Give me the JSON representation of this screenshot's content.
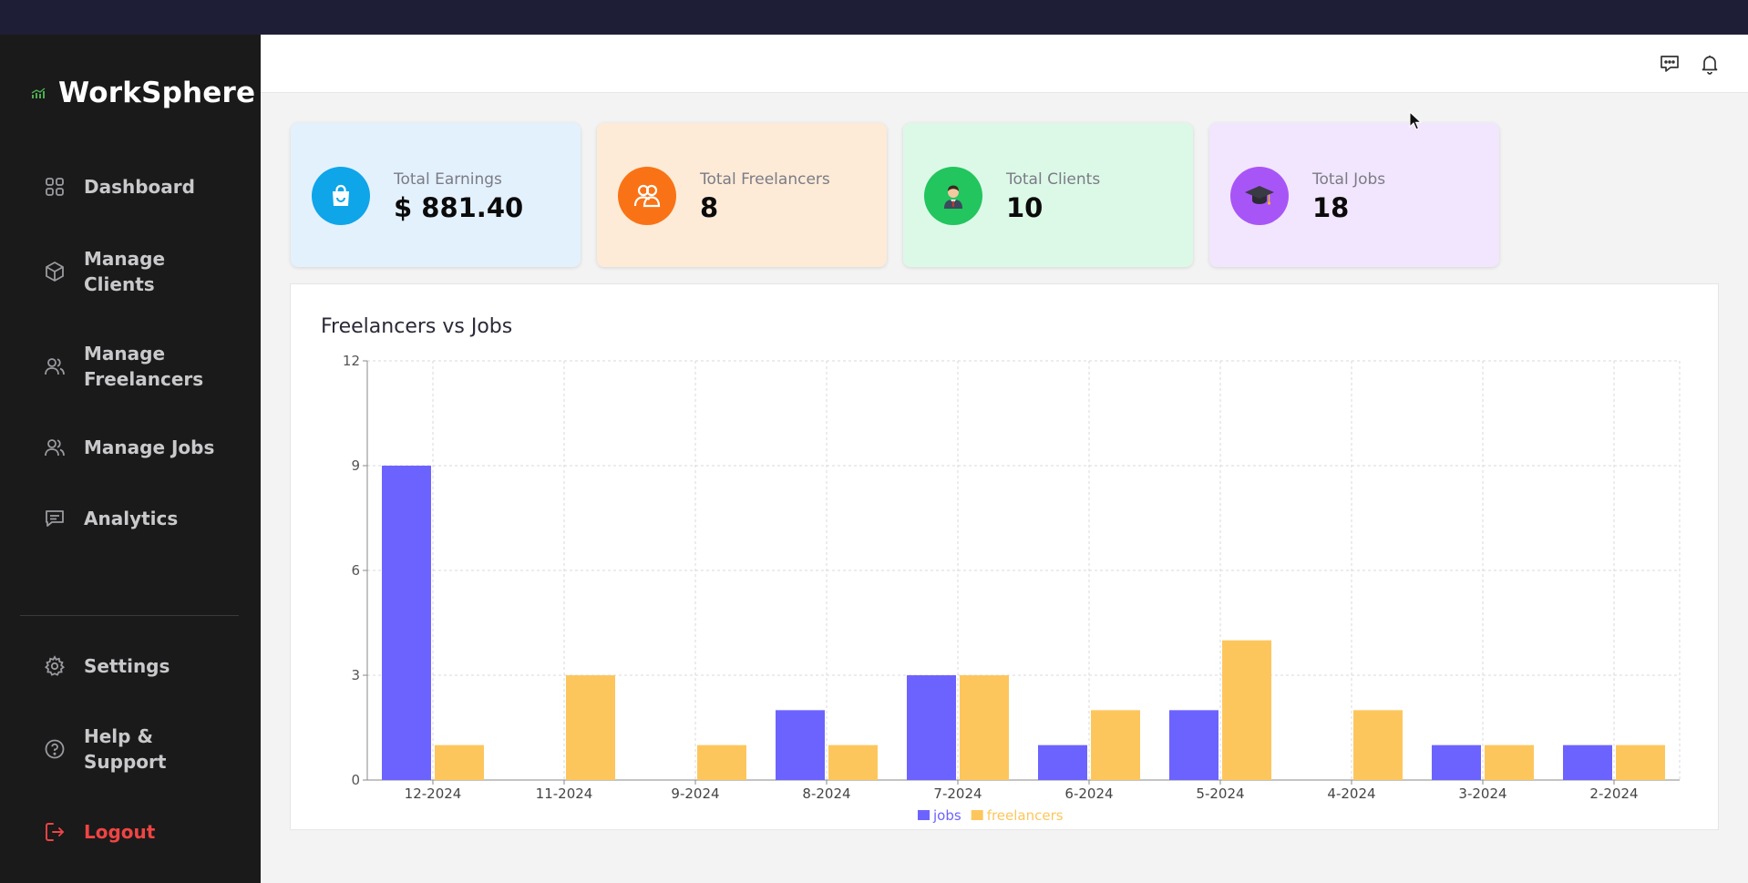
{
  "app": {
    "name": "WorkSphere",
    "accent": "#4caf50"
  },
  "sidebar": {
    "items": [
      {
        "label": "Dashboard",
        "icon": "grid-icon"
      },
      {
        "label": "Manage\nClients",
        "icon": "cube-icon"
      },
      {
        "label": "Manage\nFreelancers",
        "icon": "users-icon"
      },
      {
        "label": "Manage Jobs",
        "icon": "users-icon"
      },
      {
        "label": "Analytics",
        "icon": "message-icon"
      }
    ],
    "bottom": [
      {
        "label": "Settings",
        "icon": "gear-icon"
      },
      {
        "label": "Help &\nSupport",
        "icon": "help-circle-icon"
      },
      {
        "label": "Logout",
        "icon": "logout-icon"
      }
    ]
  },
  "header": {
    "icons": [
      "chat-icon",
      "bell-icon"
    ]
  },
  "stats": [
    {
      "title": "Total Earnings",
      "value": "$ 881.40",
      "bg": "#e3f1fd",
      "circle": "#0ea5e9",
      "icon": "shopping-bag-icon"
    },
    {
      "title": "Total Freelancers",
      "value": "8",
      "bg": "#fdebd7",
      "circle": "#f97316",
      "icon": "users-icon"
    },
    {
      "title": "Total Clients",
      "value": "10",
      "bg": "#dcf9e7",
      "circle": "#22c55e",
      "icon": "businessman-icon"
    },
    {
      "title": "Total Jobs",
      "value": "18",
      "bg": "#f1e6fd",
      "circle": "#a855f7",
      "icon": "graduation-cap-icon"
    }
  ],
  "chart_data": {
    "type": "bar",
    "title": "Freelancers vs Jobs",
    "categories": [
      "12-2024",
      "11-2024",
      "9-2024",
      "8-2024",
      "7-2024",
      "6-2024",
      "5-2024",
      "4-2024",
      "3-2024",
      "2-2024"
    ],
    "series": [
      {
        "name": "jobs",
        "color": "#6c63ff",
        "values": [
          9,
          0,
          0,
          2,
          3,
          1,
          2,
          0,
          1,
          1
        ]
      },
      {
        "name": "freelancers",
        "color": "#fdc65d",
        "values": [
          1,
          3,
          1,
          1,
          3,
          2,
          4,
          2,
          1,
          1
        ]
      }
    ],
    "ylim": [
      0,
      12
    ],
    "yticks": [
      0,
      3,
      6,
      9,
      12
    ],
    "grid": true,
    "legend": "bottom-center"
  }
}
